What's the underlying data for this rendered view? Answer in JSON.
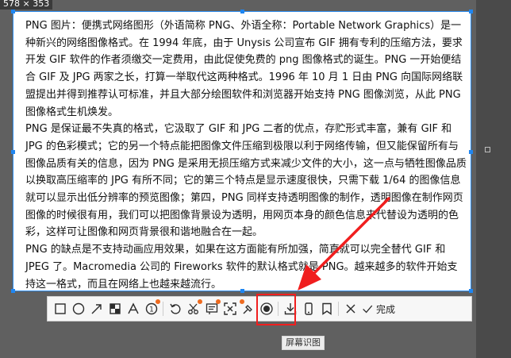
{
  "selection": {
    "size_label": "578 × 353"
  },
  "document": {
    "paragraphs": [
      "PNG 图片：便携式网络图形（外语简称 PNG、外语全称：Portable Network Graphics）是一种新兴的网络图像格式。在 1994 年底，由于 Unysis 公司宣布 GIF 拥有专利的压缩方法，要求开发 GIF 软件的作者须缴交一定费用，由此促使免费的 png 图像格式的诞生。PNG 一开始便结合 GIF 及 JPG 两家之长，打算一举取代这两种格式。1996 年 10 月 1 日由 PNG 向国际网络联盟提出并得到推荐认可标准，并且大部分绘图软件和浏览器开始支持 PNG 图像浏览，从此 PNG 图像格式生机焕发。",
      "PNG 是保证最不失真的格式，它汲取了 GIF 和 JPG 二者的优点，存贮形式丰富，兼有 GIF 和 JPG 的色彩模式；它的另一个特点能把图像文件压缩到极限以利于网络传输，但又能保留所有与图像品质有关的信息，因为 PNG 是采用无损压缩方式来减少文件的大小，这一点与牺牲图像品质以换取高压缩率的 JPG 有所不同；它的第三个特点是显示速度很快，只需下载 1/64 的图像信息就可以显示出低分辨率的预览图像；第四，PNG 同样支持透明图像的制作，透明图像在制作网页图像的时候很有用，我们可以把图像背景设为透明，用网页本身的颜色信息来代替设为透明的色彩，这样可让图像和网页背景很和谐地融合在一起。",
      "PNG 的缺点是不支持动画应用效果，如果在这方面能有所加强，简直就可以完全替代 GIF 和 JPEG 了。Macromedia 公司的 Fireworks 软件的默认格式就是 PNG。越来越多的软件开始支持这一格式，而且在网络上也越来越流行。"
    ]
  },
  "toolbar": {
    "done_label": "完成",
    "tooltip": "屏幕识图"
  },
  "colors": {
    "accent": "#1f86f1",
    "highlight": "#f01e1e",
    "badge": "#ef6b1f"
  }
}
